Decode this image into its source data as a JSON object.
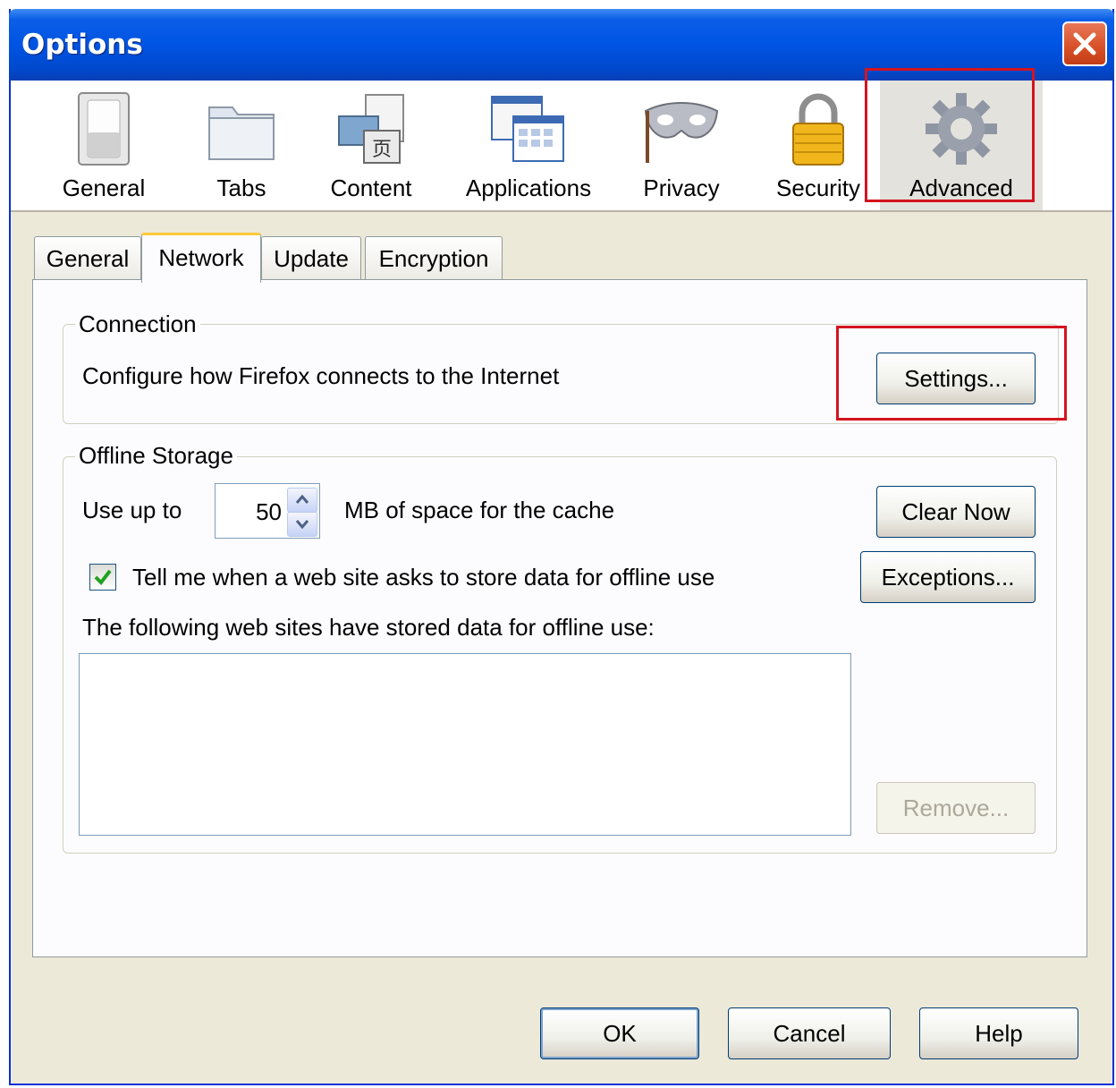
{
  "window": {
    "title": "Options"
  },
  "panes": [
    {
      "label": "General",
      "icon": "general-switch-icon"
    },
    {
      "label": "Tabs",
      "icon": "folder-tabs-icon"
    },
    {
      "label": "Content",
      "icon": "content-page-icon"
    },
    {
      "label": "Applications",
      "icon": "applications-window-icon"
    },
    {
      "label": "Privacy",
      "icon": "privacy-mask-icon"
    },
    {
      "label": "Security",
      "icon": "padlock-icon"
    },
    {
      "label": "Advanced",
      "icon": "gear-icon",
      "selected": true
    }
  ],
  "subtabs": [
    {
      "label": "General"
    },
    {
      "label": "Network",
      "active": true
    },
    {
      "label": "Update"
    },
    {
      "label": "Encryption"
    }
  ],
  "connection": {
    "caption": "Connection",
    "description": "Configure how Firefox connects to the Internet",
    "settings_label": "Settings..."
  },
  "offline": {
    "caption": "Offline Storage",
    "use_up_to_label": "Use up to",
    "cache_value": "50",
    "cache_suffix": "MB of space for the cache",
    "clear_now_label": "Clear Now",
    "exceptions_label": "Exceptions...",
    "notify_label": "Tell me when a web site asks to store data for offline use",
    "notify_checked": true,
    "stored_sites_label": "The following web sites have stored data for offline use:",
    "stored_sites": [],
    "remove_label": "Remove..."
  },
  "footer": {
    "ok_label": "OK",
    "cancel_label": "Cancel",
    "help_label": "Help"
  },
  "colors": {
    "titlebar": "#0054e3",
    "highlight": "#d4141e",
    "active_tab_accent": "#ffc73c"
  }
}
